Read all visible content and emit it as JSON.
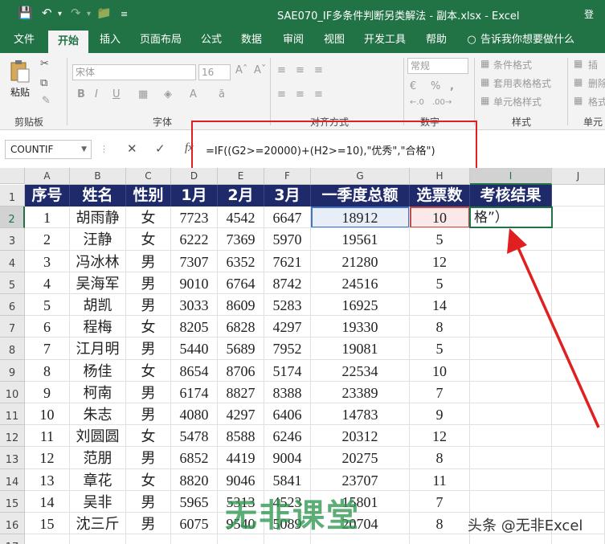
{
  "title_bar": {
    "title": "SAE070_IF多条件判断另类解法 - 副本.xlsx  -  Excel",
    "user_initial": "登",
    "qa_icons": [
      "save-icon",
      "undo-icon",
      "redo-icon",
      "folder-icon",
      "customize-icon"
    ]
  },
  "tabs": [
    {
      "label": "文件",
      "active": false
    },
    {
      "label": "开始",
      "active": true
    },
    {
      "label": "插入",
      "active": false
    },
    {
      "label": "页面布局",
      "active": false
    },
    {
      "label": "公式",
      "active": false
    },
    {
      "label": "数据",
      "active": false
    },
    {
      "label": "审阅",
      "active": false
    },
    {
      "label": "视图",
      "active": false
    },
    {
      "label": "开发工具",
      "active": false
    },
    {
      "label": "帮助",
      "active": false
    },
    {
      "label": "告诉我你想要做什么",
      "active": false
    }
  ],
  "ribbon": {
    "paste_label": "粘贴",
    "font_name": "宋体",
    "font_size": "16",
    "number_format": "常规",
    "groups": {
      "clipboard": "剪贴板",
      "font": "字体",
      "alignment": "对齐方式",
      "number": "数字",
      "styles": "样式",
      "cells": "单元"
    },
    "styles_items": [
      "条件格式",
      "套用表格格式",
      "单元格样式"
    ],
    "cells_items": [
      "插",
      "删除",
      "格式"
    ]
  },
  "formula_bar": {
    "name_box": "COUNTIF",
    "fx_label": "fx",
    "formula": "=IF((G2>=20000)+(H2>=10),\"优秀\",\"合格\")"
  },
  "columns": [
    "A",
    "B",
    "C",
    "D",
    "E",
    "F",
    "G",
    "H",
    "I",
    "J"
  ],
  "headers": [
    "序号",
    "姓名",
    "性别",
    "1月",
    "2月",
    "3月",
    "一季度总额",
    "选票数",
    "考核结果"
  ],
  "rows": [
    [
      "1",
      "胡雨静",
      "女",
      "7723",
      "4542",
      "6647",
      "18912",
      "10",
      ""
    ],
    [
      "2",
      "汪静",
      "女",
      "6222",
      "7369",
      "5970",
      "19561",
      "5",
      ""
    ],
    [
      "3",
      "冯冰林",
      "男",
      "7307",
      "6352",
      "7621",
      "21280",
      "12",
      ""
    ],
    [
      "4",
      "吴海军",
      "男",
      "9010",
      "6764",
      "8742",
      "24516",
      "5",
      ""
    ],
    [
      "5",
      "胡凯",
      "男",
      "3033",
      "8609",
      "5283",
      "16925",
      "14",
      ""
    ],
    [
      "6",
      "程梅",
      "女",
      "8205",
      "6828",
      "4297",
      "19330",
      "8",
      ""
    ],
    [
      "7",
      "江月明",
      "男",
      "5440",
      "5689",
      "7952",
      "19081",
      "5",
      ""
    ],
    [
      "8",
      "杨佳",
      "女",
      "8654",
      "8706",
      "5174",
      "22534",
      "10",
      ""
    ],
    [
      "9",
      "柯南",
      "男",
      "6174",
      "8827",
      "8388",
      "23389",
      "7",
      ""
    ],
    [
      "10",
      "朱志",
      "男",
      "4080",
      "4297",
      "6406",
      "14783",
      "9",
      ""
    ],
    [
      "11",
      "刘圆圆",
      "女",
      "5478",
      "8588",
      "6246",
      "20312",
      "12",
      ""
    ],
    [
      "12",
      "范朋",
      "男",
      "6852",
      "4419",
      "9004",
      "20275",
      "8",
      ""
    ],
    [
      "13",
      "章花",
      "女",
      "8820",
      "9046",
      "5841",
      "23707",
      "11",
      ""
    ],
    [
      "14",
      "吴非",
      "男",
      "5965",
      "5313",
      "4523",
      "15801",
      "7",
      ""
    ],
    [
      "15",
      "沈三斤",
      "男",
      "6075",
      "9540",
      "5089",
      "20704",
      "8",
      ""
    ]
  ],
  "active_cell_text": "格”）",
  "watermark": "无非课堂",
  "credit": "头条 @无非Excel",
  "colors": {
    "excel_green": "#217346",
    "header_fill": "#1f2a6b",
    "highlight_red": "#e02020",
    "g2_ref": "#4472c4",
    "h2_ref": "#c0504d"
  }
}
